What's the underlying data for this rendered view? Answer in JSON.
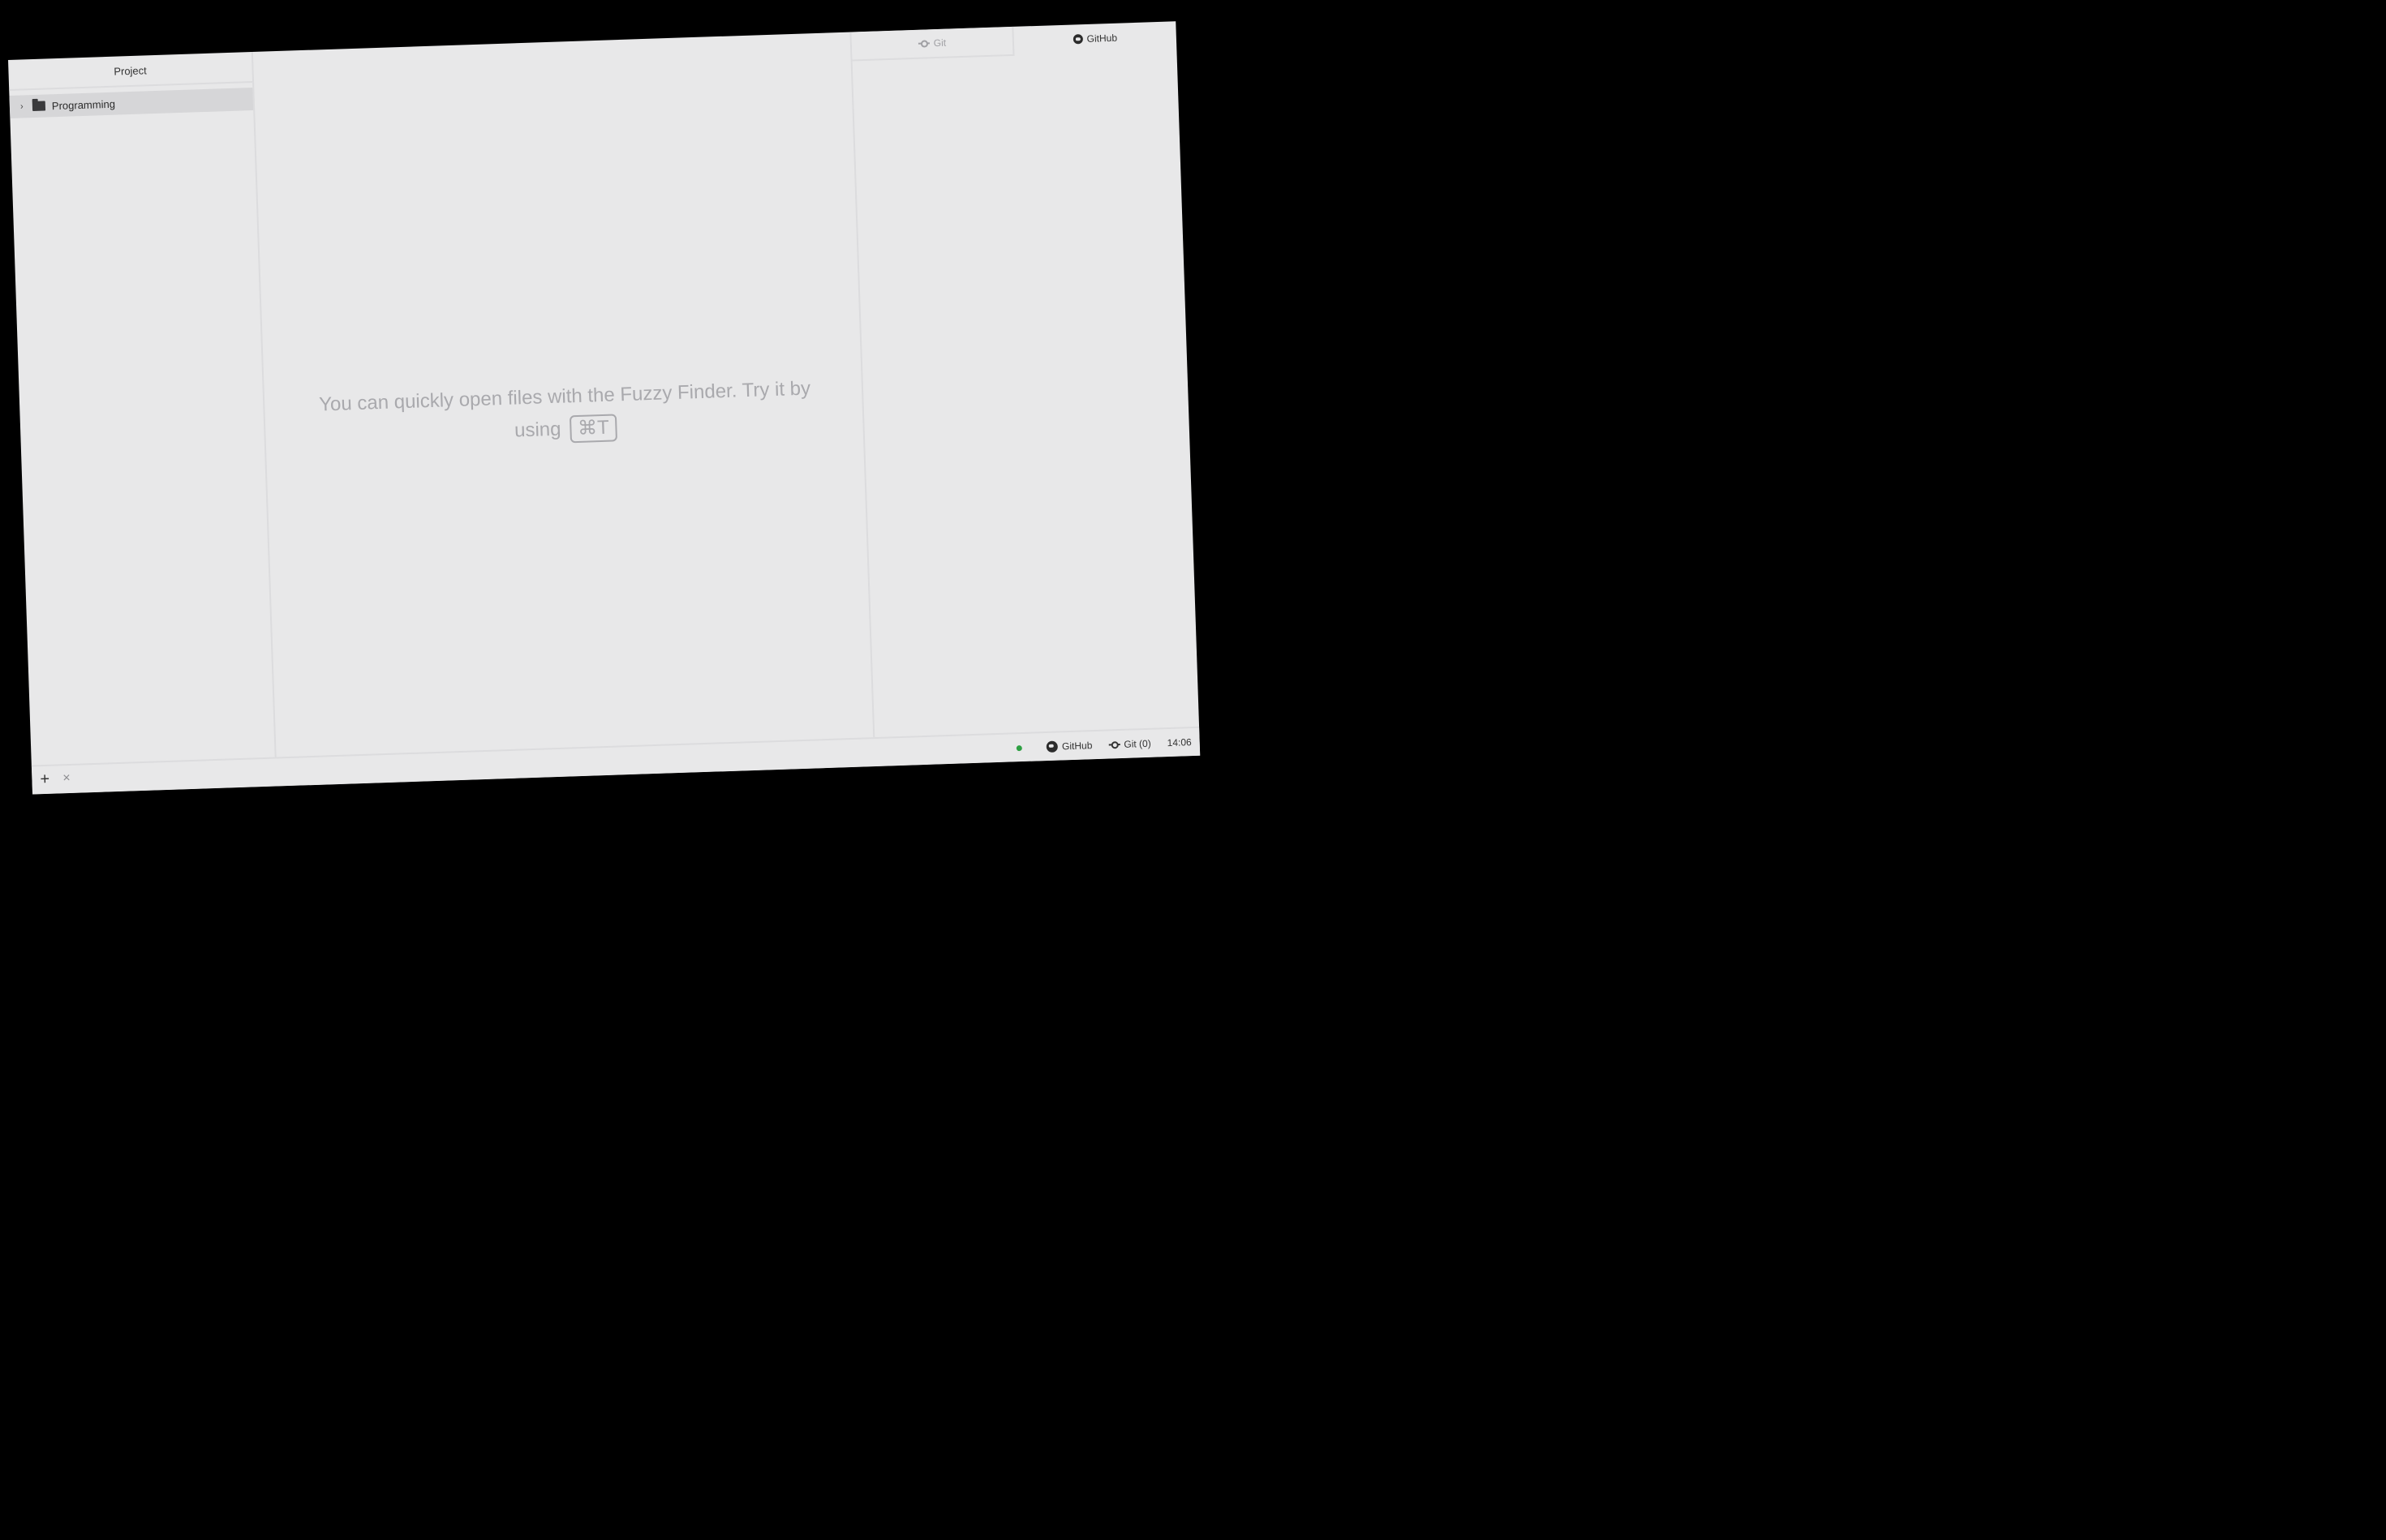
{
  "tree_view": {
    "header": "Project",
    "items": [
      {
        "label": "Programming",
        "expanded": false
      }
    ]
  },
  "workspace": {
    "hint_text": "You can quickly open files with the Fuzzy Finder. Try it by using",
    "hint_shortcut": "⌘T"
  },
  "dock": {
    "tabs": [
      {
        "label": "Git",
        "active": false
      },
      {
        "label": "GitHub",
        "active": true
      }
    ]
  },
  "status_bar": {
    "add_label": "+",
    "close_label": "×",
    "github_label": "GitHub",
    "git_label": "Git (0)",
    "time": "14:06",
    "status_dot_color": "#2ea043"
  },
  "icons": {
    "tree_chevron": "chevron-right-icon",
    "tree_folder": "folder-icon",
    "git": "git-commit-icon",
    "github": "github-icon"
  }
}
